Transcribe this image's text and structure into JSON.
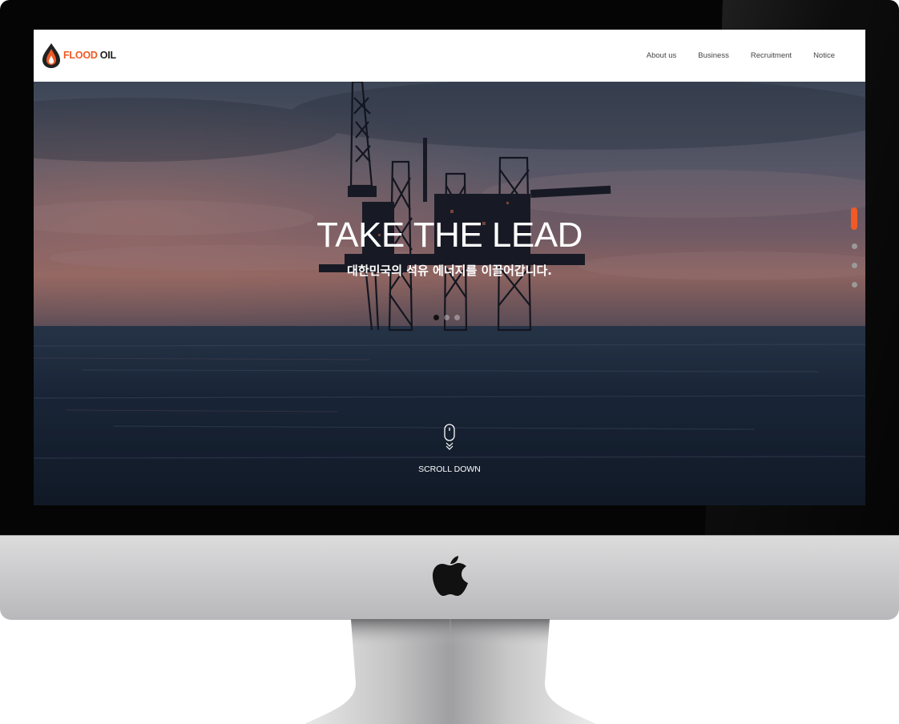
{
  "site": {
    "brand_part1": "FLOOD",
    "brand_part2": "OIL",
    "nav": [
      "About us",
      "Business",
      "Recruitment",
      "Notice"
    ]
  },
  "hero": {
    "headline": "TAKE THE LEAD",
    "subline": "대한민국의 석유 에너지를 이끌어갑니다.",
    "image_subject": "offshore oil rig at sea at sunset",
    "slides_total": 3,
    "slide_active": 1,
    "sections_total": 4,
    "section_active": 1,
    "scroll_label": "SCROLL DOWN"
  },
  "device": {
    "frame": "iMac",
    "logo": "apple-logo-icon"
  },
  "colors": {
    "accent": "#f15a24",
    "brand_orange": "#ee5a24",
    "brand_dark": "#222222"
  }
}
